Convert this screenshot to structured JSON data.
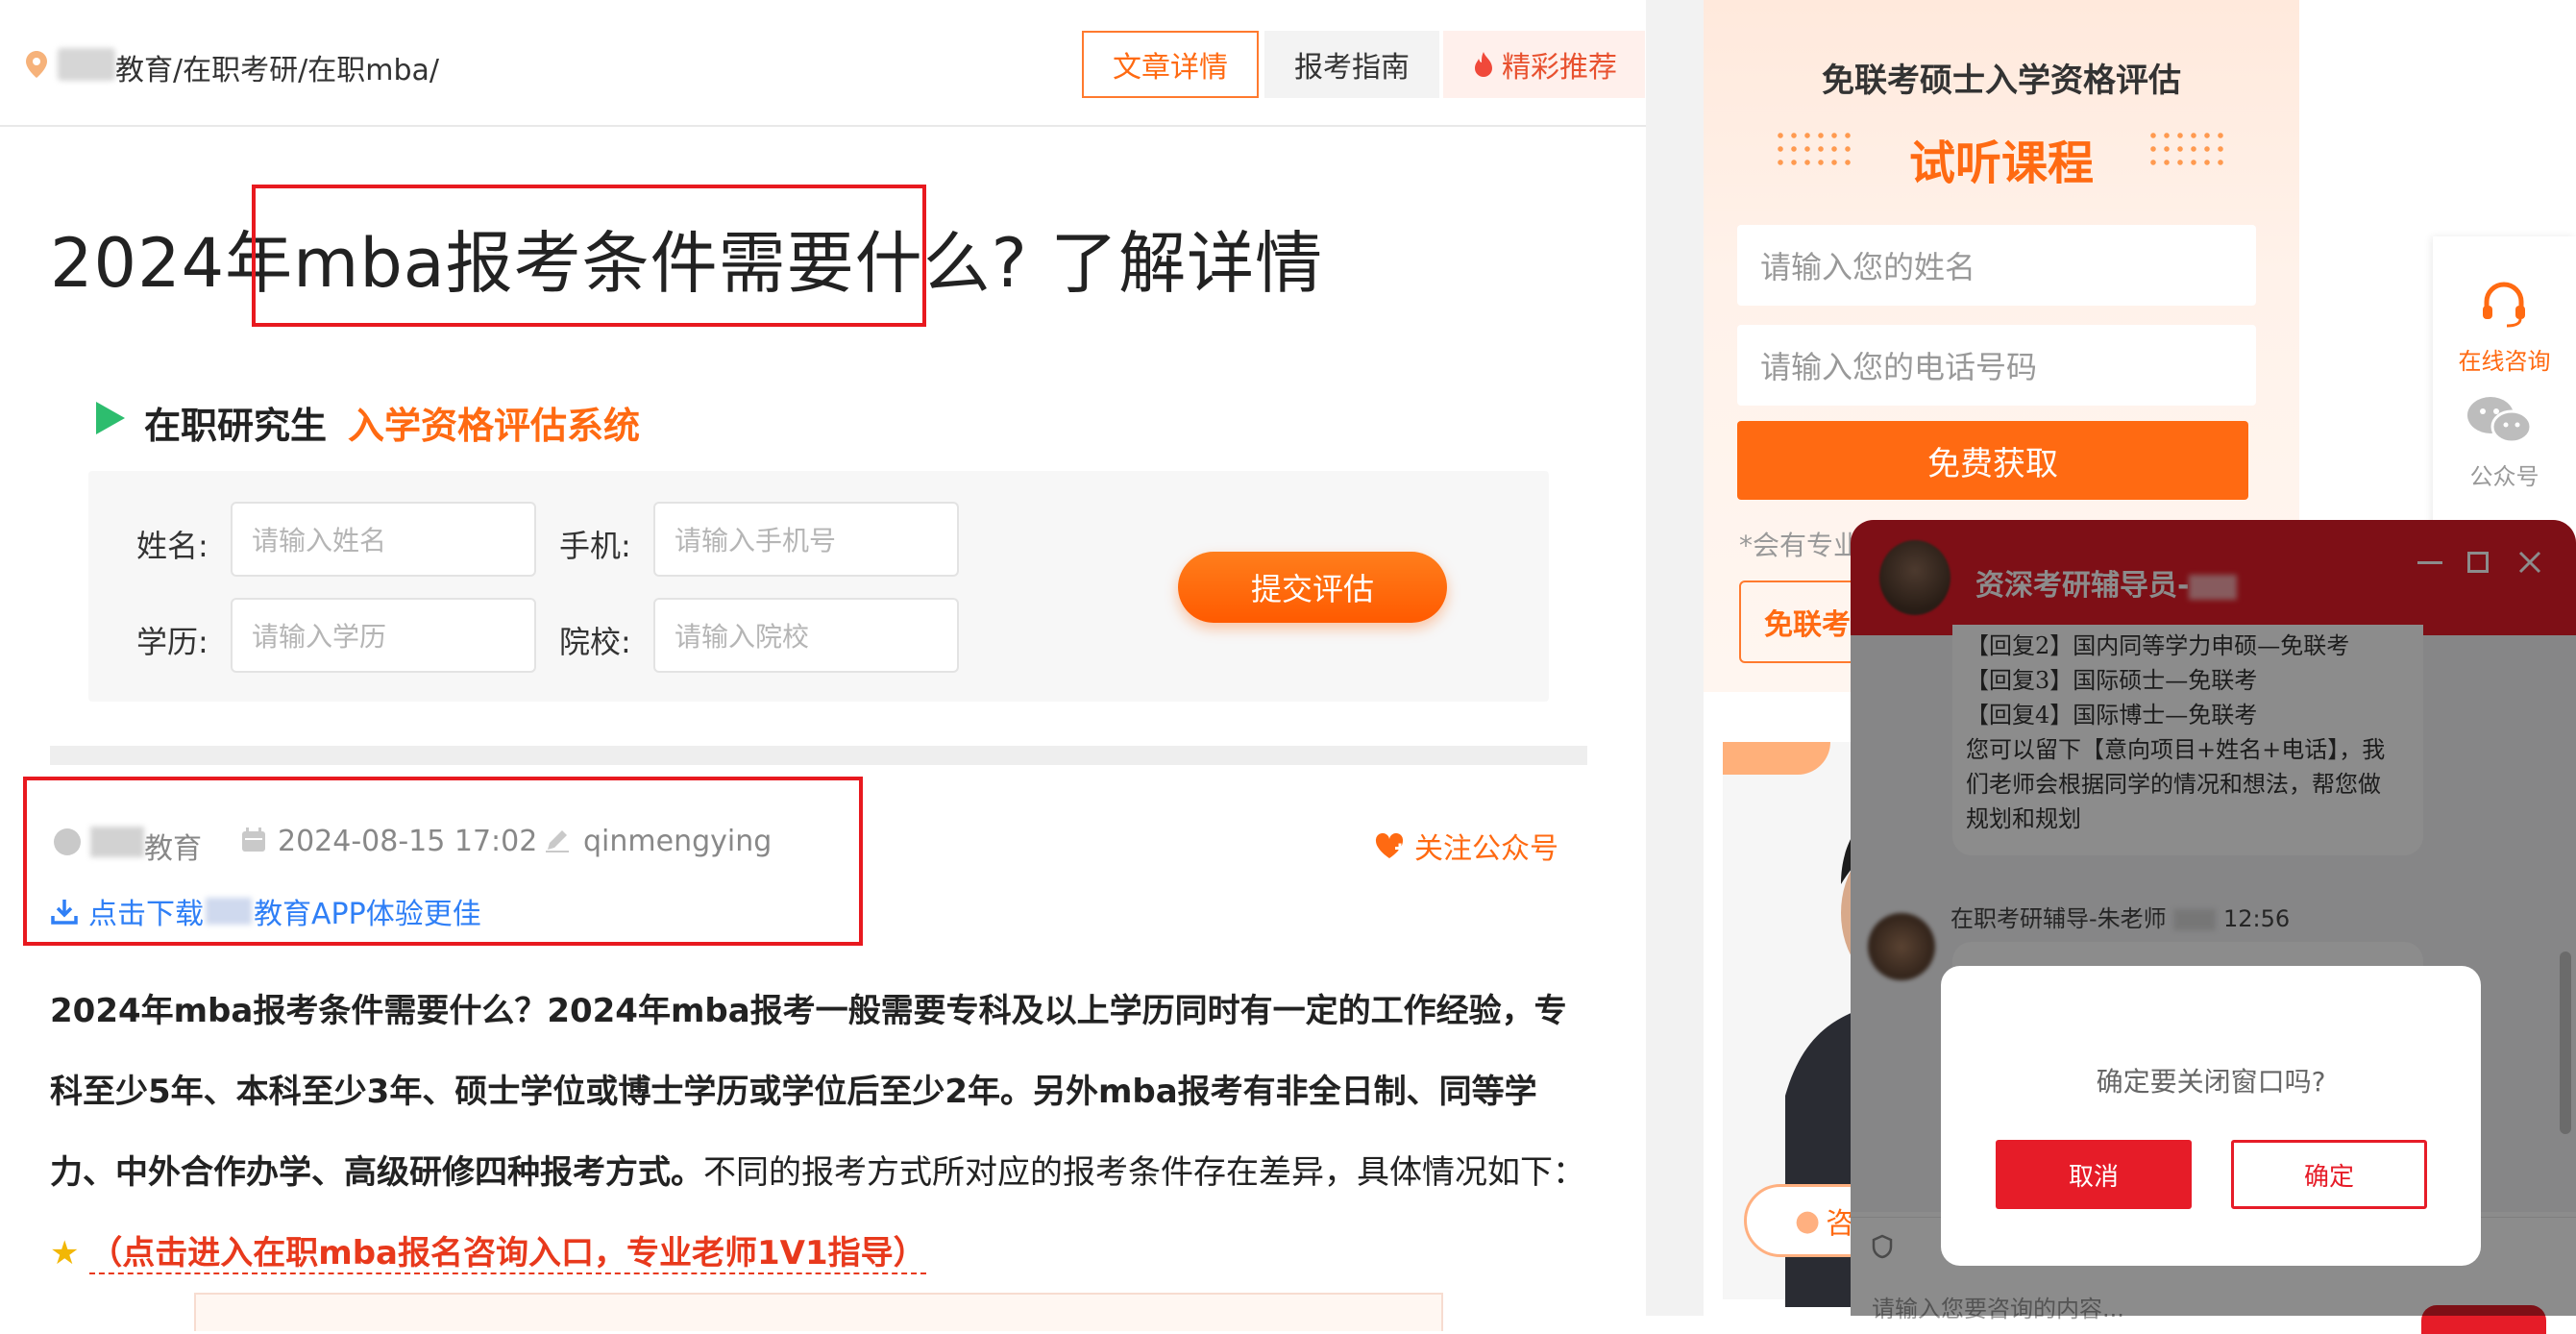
{
  "breadcrumb": {
    "text": "教育/在职考研/在职mba/"
  },
  "tabs": [
    {
      "label": "文章详情"
    },
    {
      "label": "报考指南"
    },
    {
      "label": "精彩推荐"
    }
  ],
  "article": {
    "title_pre": "2024年",
    "title_hl": "mba报考条件需要什么?",
    "title_post": " 了解详情",
    "meta": {
      "source": "教育",
      "date": "2024-08-15 17:02",
      "author": "qinmengying",
      "follow": "关注公众号",
      "download_a": "点击下载",
      "download_b": "教育APP体验更佳"
    },
    "body": {
      "bold": "2024年mba报考条件需要什么？2024年mba报考一般需要专科及以上学历同时有一定的工作经验，专科至少5年、本科至少3年、硕士学位或博士学历或学位后至少2年。另外mba报考有非全日制、同等学力、中外合作办学、高级研修四种报考方式。",
      "normal": "不同的报考方式所对应的报考条件存在差异，具体情况如下：",
      "link": "（点击进入在职mba报名咨询入口，专业老师1V1指导）"
    }
  },
  "eval_form": {
    "title_a": "在职研究生",
    "title_b": "入学资格评估系统",
    "name_label": "姓名:",
    "name_placeholder": "请输入姓名",
    "phone_label": "手机:",
    "phone_placeholder": "请输入手机号",
    "edu_label": "学历:",
    "edu_placeholder": "请输入学历",
    "school_label": "院校:",
    "school_placeholder": "请输入院校",
    "submit": "提交评估"
  },
  "promo": {
    "title": "免联考硕士入学资格评估",
    "subtitle": "试听课程",
    "name_placeholder": "请输入您的姓名",
    "phone_placeholder": "请输入您的电话号码",
    "button": "免费获取",
    "note": "*会有专业",
    "button2": "免联考"
  },
  "teacher_card": {
    "consult": "咨"
  },
  "sidebar": [
    {
      "label": "在线咨询"
    },
    {
      "label": "公众号"
    }
  ],
  "chat": {
    "title": "资深考研辅导员-",
    "bubble_lines": [
      "【回复2】国内同等学力申硕—免联考",
      "【回复3】国际硕士—免联考",
      "【回复4】国际博士—免联考",
      "您可以留下【意向项目+姓名+电话】，我",
      "们老师会根据同学的情况和想法，帮您做",
      "规划和规划"
    ],
    "msg2_name": "在职考研辅导-朱老师",
    "msg2_time": "12:56",
    "input_placeholder": "请输入您要咨询的内容..."
  },
  "dialog": {
    "message": "确定要关闭窗口吗?",
    "cancel": "取消",
    "ok": "确定"
  },
  "colors": {
    "accent": "#ff6a12",
    "red": "#e61c28",
    "green": "#2dbd6e",
    "link": "#2f7ff6"
  }
}
